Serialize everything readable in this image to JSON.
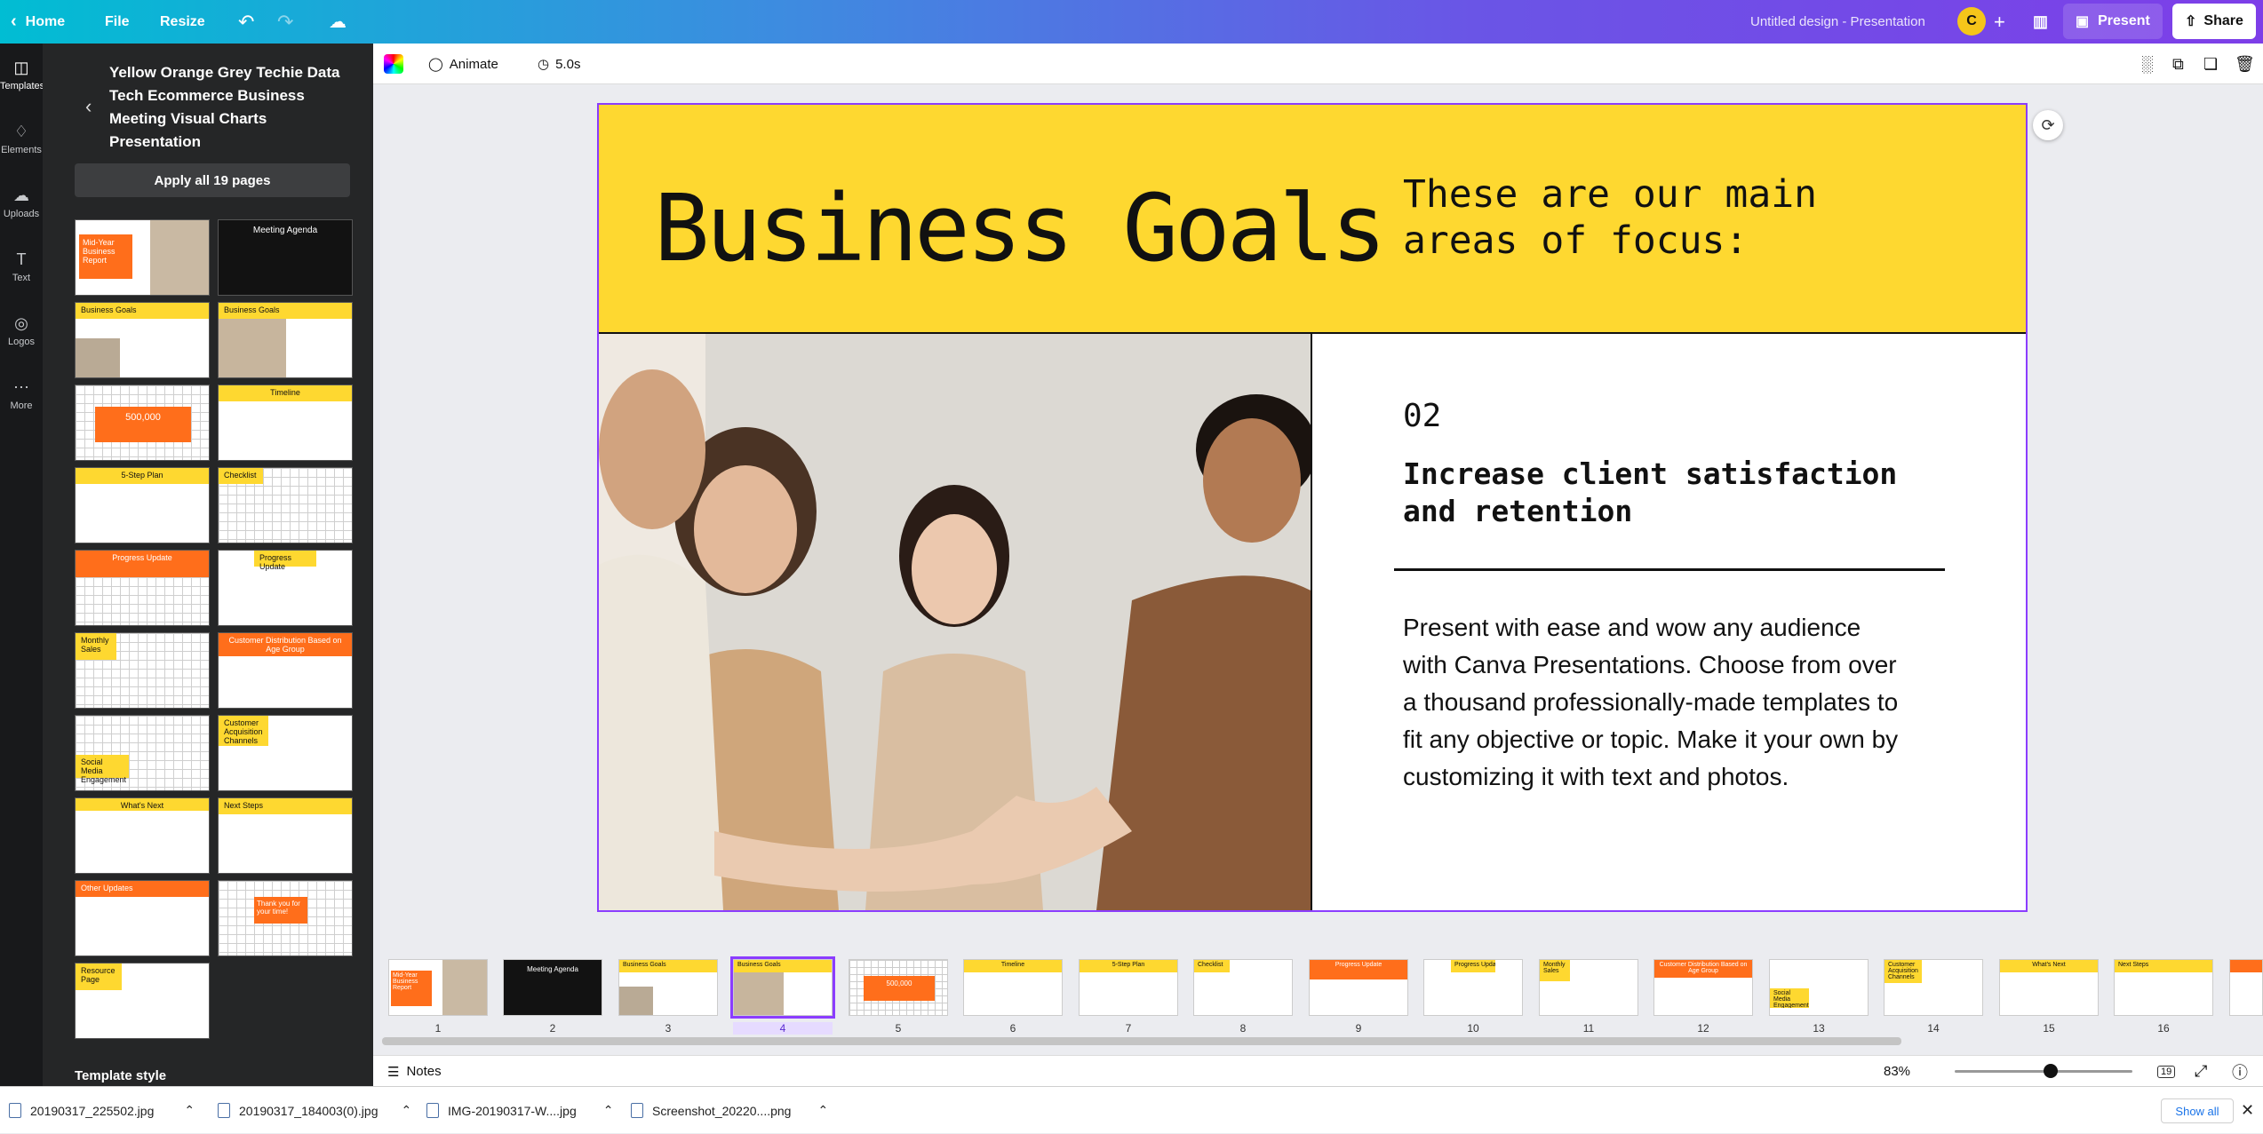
{
  "topbar": {
    "home": "Home",
    "file": "File",
    "resize": "Resize",
    "doc_title": "Untitled design - Presentation",
    "avatar_letter": "C",
    "present": "Present",
    "share": "Share"
  },
  "rail": [
    {
      "label": "Templates",
      "icon": "templates-icon"
    },
    {
      "label": "Elements",
      "icon": "elements-icon"
    },
    {
      "label": "Uploads",
      "icon": "uploads-icon"
    },
    {
      "label": "Text",
      "icon": "text-icon"
    },
    {
      "label": "Logos",
      "icon": "logos-icon"
    },
    {
      "label": "More",
      "icon": "more-icon"
    }
  ],
  "panel": {
    "title": "Yellow Orange Grey Techie Data Tech Ecommerce Business Meeting Visual Charts Presentation",
    "apply_label": "Apply all 19 pages",
    "template_style": "Template style",
    "thumbs": [
      "Mid-Year Business Report",
      "Meeting Agenda",
      "Business Goals",
      "Business Goals",
      "500,000",
      "Timeline",
      "5-Step Plan",
      "Checklist",
      "Progress Update",
      "Progress Update",
      "Monthly Sales",
      "Customer Distribution Based on Age Group",
      "Social Media Engagement",
      "Customer Acquisition Channels",
      "What's Next",
      "Next Steps",
      "Other Updates",
      "Thank you for your time!",
      "Resource Page"
    ]
  },
  "ctx": {
    "animate": "Animate",
    "duration": "5.0s"
  },
  "slide": {
    "title": "Business Goals",
    "subtitle": "These are our main areas of focus:",
    "number": "02",
    "heading": "Increase client satisfaction and retention",
    "body": "Present with ease and wow any audience with Canva Presentations. Choose from over a thousand professionally-made templates to fit any objective or topic. Make it your own by customizing it with text and photos."
  },
  "strip": {
    "thumbs": [
      {
        "num": "1",
        "label": "Mid-Year Business Report"
      },
      {
        "num": "2",
        "label": "Meeting Agenda"
      },
      {
        "num": "3",
        "label": "Business Goals"
      },
      {
        "num": "4",
        "label": "Business Goals"
      },
      {
        "num": "5",
        "label": "500,000"
      },
      {
        "num": "6",
        "label": "Timeline"
      },
      {
        "num": "7",
        "label": "5-Step Plan"
      },
      {
        "num": "8",
        "label": "Checklist"
      },
      {
        "num": "9",
        "label": "Progress Update"
      },
      {
        "num": "10",
        "label": "Progress Update"
      },
      {
        "num": "11",
        "label": "Monthly Sales"
      },
      {
        "num": "12",
        "label": "Customer Distribution Based on Age Group"
      },
      {
        "num": "13",
        "label": "Social Media Engagement"
      },
      {
        "num": "14",
        "label": "Customer Acquisition Channels"
      },
      {
        "num": "15",
        "label": "What's Next"
      },
      {
        "num": "16",
        "label": "Next Steps"
      }
    ],
    "active_index": 3
  },
  "bottom": {
    "notes": "Notes",
    "zoom": "83%",
    "page_count": "19"
  },
  "downloads": {
    "files": [
      "20190317_225502.jpg",
      "20190317_184003(0).jpg",
      "IMG-20190317-W....jpg",
      "Screenshot_20220....png"
    ],
    "show_all": "Show all"
  },
  "colors": {
    "accent": "#8b3dff",
    "slide_yellow": "#fed830",
    "slide_orange": "#ff6e1b"
  }
}
